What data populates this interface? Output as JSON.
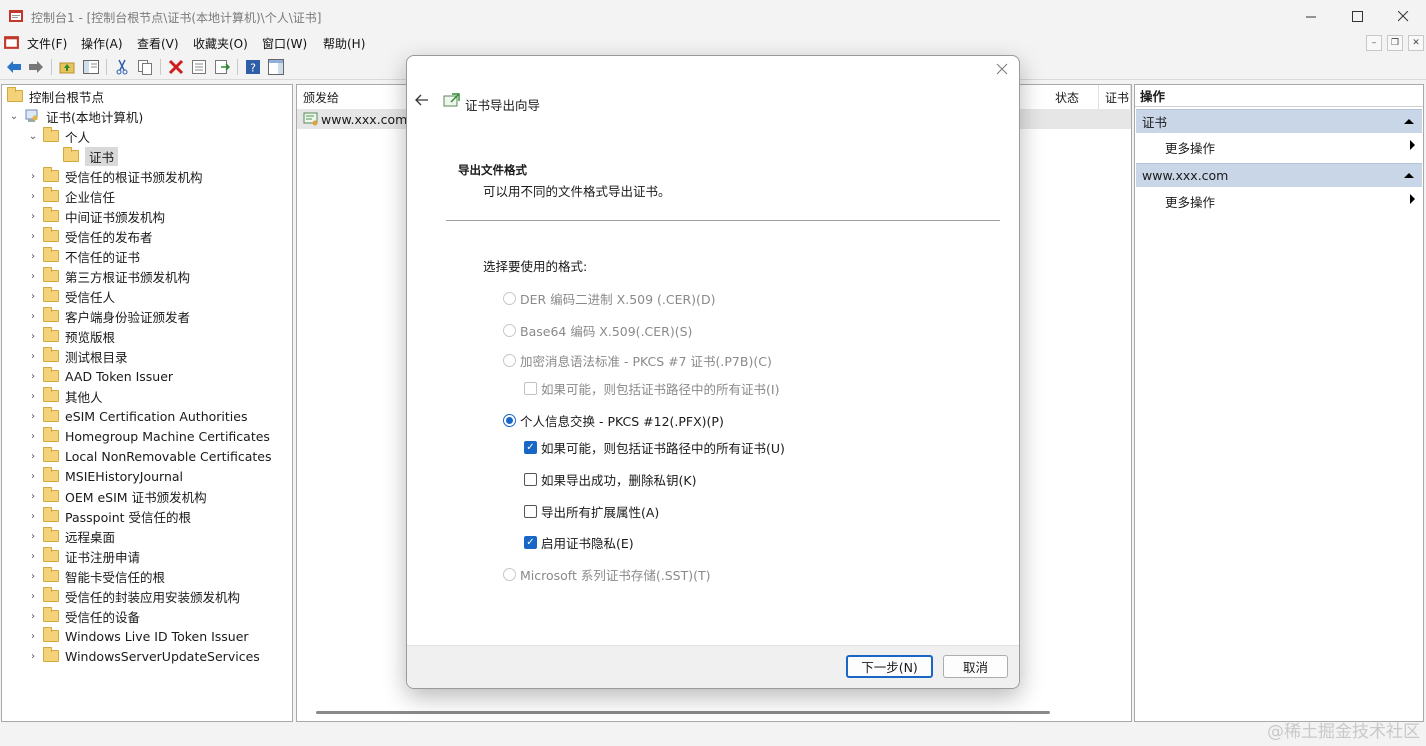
{
  "window": {
    "title": "控制台1 - [控制台根节点\\证书(本地计算机)\\个人\\证书]",
    "controls": [
      "minimize-icon",
      "maximize-icon",
      "close-icon"
    ]
  },
  "menu": [
    "文件(F)",
    "操作(A)",
    "查看(V)",
    "收藏夹(O)",
    "窗口(W)",
    "帮助(H)"
  ],
  "toolbar_icons": [
    "back-arrow-icon",
    "forward-arrow-icon",
    "up-folder-icon",
    "show-hide-tree-icon",
    "cut-icon",
    "copy-icon",
    "delete-icon",
    "properties-icon",
    "export-list-icon",
    "help-icon",
    "show-hide-action-pane-icon"
  ],
  "tree": {
    "root": "控制台根节点",
    "computer": "证书(本地计算机)",
    "personal": "个人",
    "selected": "证书",
    "items": [
      "受信任的根证书颁发机构",
      "企业信任",
      "中间证书颁发机构",
      "受信任的发布者",
      "不信任的证书",
      "第三方根证书颁发机构",
      "受信任人",
      "客户端身份验证颁发者",
      "预览版根",
      "测试根目录",
      "AAD Token Issuer",
      "其他人",
      "eSIM Certification Authorities",
      "Homegroup Machine Certificates",
      "Local NonRemovable Certificates",
      "MSIEHistoryJournal",
      "OEM eSIM 证书颁发机构",
      "Passpoint 受信任的根",
      "远程桌面",
      "证书注册申请",
      "智能卡受信任的根",
      "受信任的封装应用安装颁发机构",
      "受信任的设备",
      "Windows Live ID Token Issuer",
      "WindowsServerUpdateServices"
    ]
  },
  "list": {
    "columns": {
      "issued_to": "颁发给",
      "status": "状态",
      "cert": "证书"
    },
    "rows": [
      "www.xxx.com"
    ]
  },
  "actions": {
    "header": "操作",
    "sections": [
      {
        "title": "证书",
        "item": "更多操作"
      },
      {
        "title": "www.xxx.com",
        "item": "更多操作"
      }
    ]
  },
  "dialog": {
    "title": "证书导出向导",
    "section_title": "导出文件格式",
    "section_desc": "可以用不同的文件格式导出证书。",
    "prompt": "选择要使用的格式:",
    "options": {
      "der": "DER 编码二进制 X.509 (.CER)(D)",
      "base64": "Base64 编码 X.509(.CER)(S)",
      "pkcs7": "加密消息语法标准 - PKCS #7 证书(.P7B)(C)",
      "pkcs7_include": "如果可能，则包括证书路径中的所有证书(I)",
      "pfx": "个人信息交换 - PKCS #12(.PFX)(P)",
      "pfx_include": "如果可能，则包括证书路径中的所有证书(U)",
      "pfx_delete_key": "如果导出成功，删除私钥(K)",
      "pfx_ext_props": "导出所有扩展属性(A)",
      "pfx_privacy": "启用证书隐私(E)",
      "sst": "Microsoft 系列证书存储(.SST)(T)"
    },
    "buttons": {
      "next": "下一步(N)",
      "cancel": "取消"
    }
  },
  "watermark": "@稀土掘金技术社区",
  "colors": {
    "accent": "#1967c5",
    "action_header": "#c9d6e8"
  }
}
